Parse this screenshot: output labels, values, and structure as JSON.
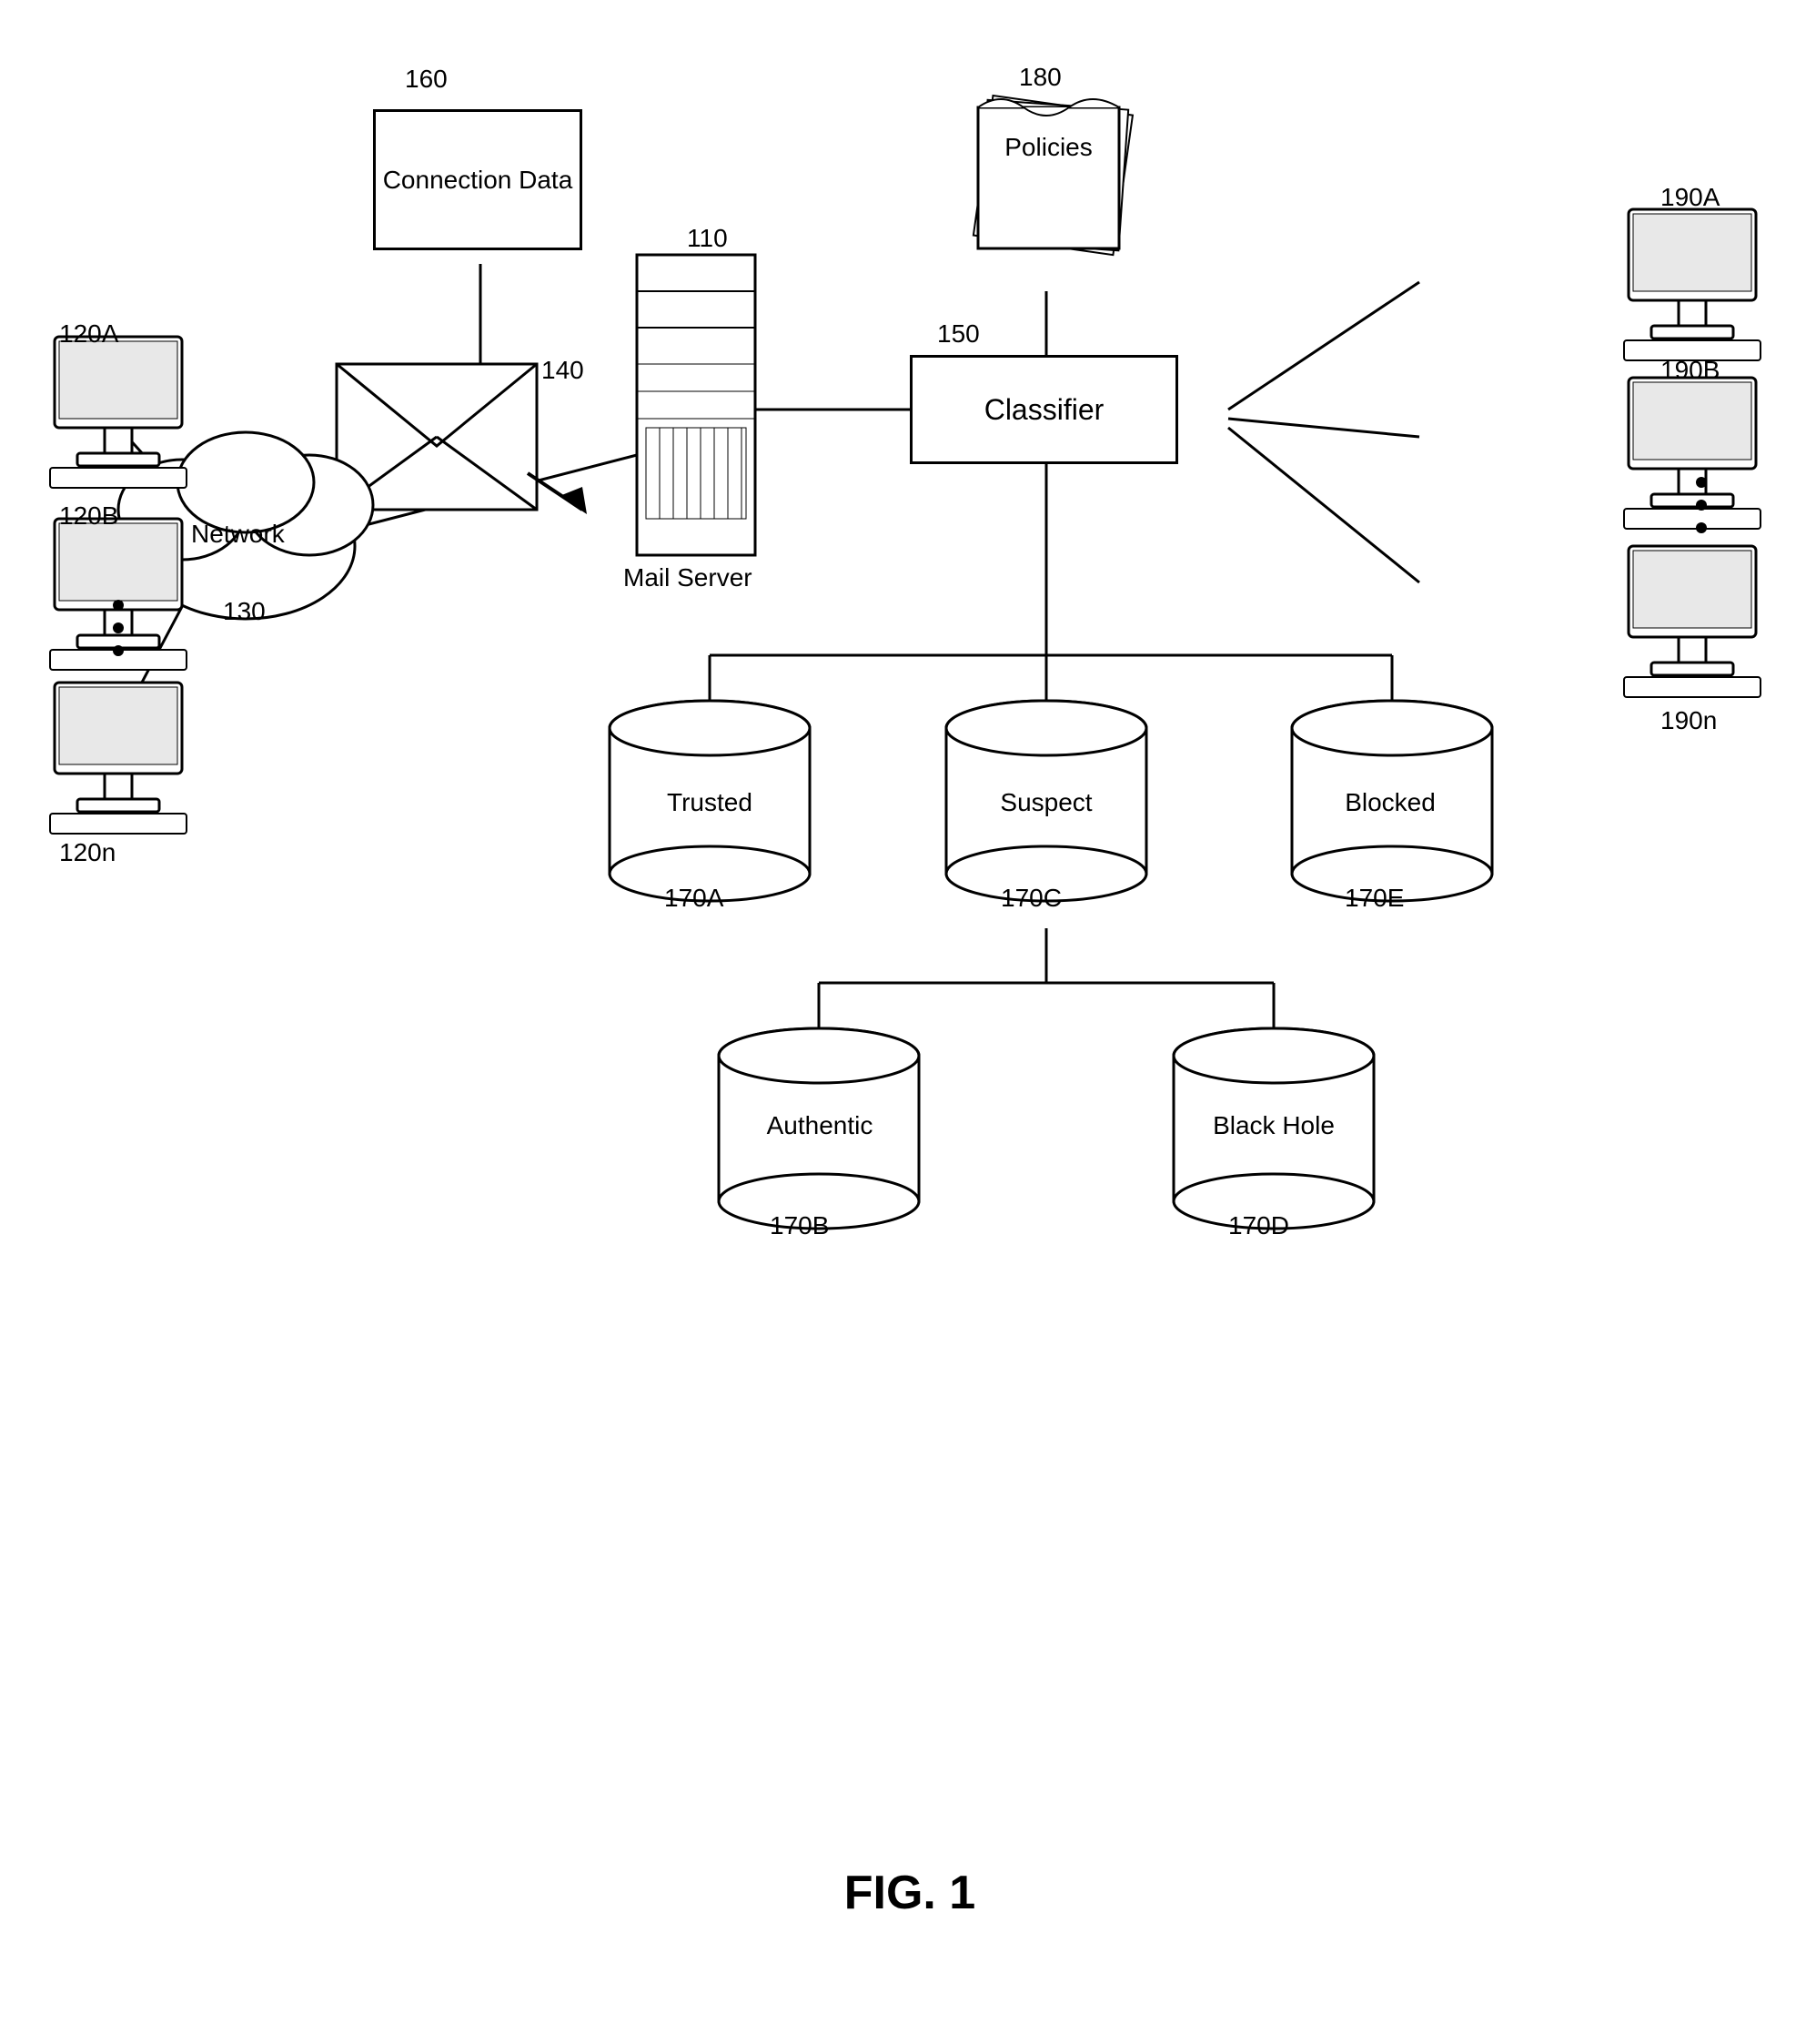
{
  "title": "FIG. 1",
  "nodes": {
    "connection_data": {
      "label": "Connection\nData",
      "ref": "160"
    },
    "mail_envelope": {
      "ref": "140"
    },
    "network": {
      "label": "Network",
      "ref": "130"
    },
    "mail_server": {
      "label": "Mail Server",
      "ref": "110"
    },
    "policies": {
      "label": "Policies",
      "ref": "180"
    },
    "classifier": {
      "label": "Classifier",
      "ref": "150"
    },
    "trusted": {
      "label": "Trusted",
      "ref": "170A"
    },
    "authentic": {
      "label": "Authentic",
      "ref": "170B"
    },
    "suspect": {
      "label": "Suspect",
      "ref": "170C"
    },
    "black_hole": {
      "label": "Black Hole",
      "ref": "170D"
    },
    "blocked": {
      "label": "Blocked",
      "ref": "170E"
    },
    "client_120a": {
      "ref": "120A"
    },
    "client_120b": {
      "ref": "120B"
    },
    "client_120n": {
      "ref": "120n"
    },
    "client_190a": {
      "ref": "190A"
    },
    "client_190b": {
      "ref": "190B"
    },
    "client_190n": {
      "ref": "190n"
    }
  },
  "fig_label": "FIG. 1"
}
